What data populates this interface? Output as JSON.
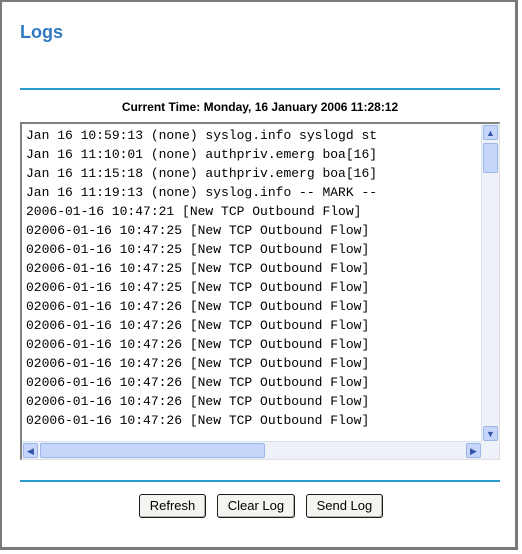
{
  "page": {
    "title": "Logs"
  },
  "current_time": "Current Time: Monday, 16 January 2006 11:28:12",
  "log": {
    "lines": [
      "Jan 16 10:59:13 (none) syslog.info syslogd st",
      "Jan 16 11:10:01 (none) authpriv.emerg boa[16]",
      "Jan 16 11:15:18 (none) authpriv.emerg boa[16]",
      "Jan 16 11:19:13 (none) syslog.info -- MARK --",
      "2006-01-16 10:47:21 [New TCP Outbound Flow] ",
      "02006-01-16 10:47:25 [New TCP Outbound Flow]",
      "02006-01-16 10:47:25 [New TCP Outbound Flow]",
      "02006-01-16 10:47:25 [New TCP Outbound Flow]",
      "02006-01-16 10:47:25 [New TCP Outbound Flow]",
      "02006-01-16 10:47:26 [New TCP Outbound Flow]",
      "02006-01-16 10:47:26 [New TCP Outbound Flow]",
      "02006-01-16 10:47:26 [New TCP Outbound Flow]",
      "02006-01-16 10:47:26 [New TCP Outbound Flow]",
      "02006-01-16 10:47:26 [New TCP Outbound Flow]",
      "02006-01-16 10:47:26 [New TCP Outbound Flow]",
      "02006-01-16 10:47:26 [New TCP Outbound Flow]"
    ]
  },
  "scrollbar_icons": {
    "up": "arrow-up-icon",
    "down": "arrow-down-icon",
    "left": "arrow-left-icon",
    "right": "arrow-right-icon"
  },
  "buttons": {
    "refresh": "Refresh",
    "clear_log": "Clear Log",
    "send_log": "Send Log"
  },
  "colors": {
    "title": "#2f7ac2",
    "rule": "#2a9bd3"
  }
}
